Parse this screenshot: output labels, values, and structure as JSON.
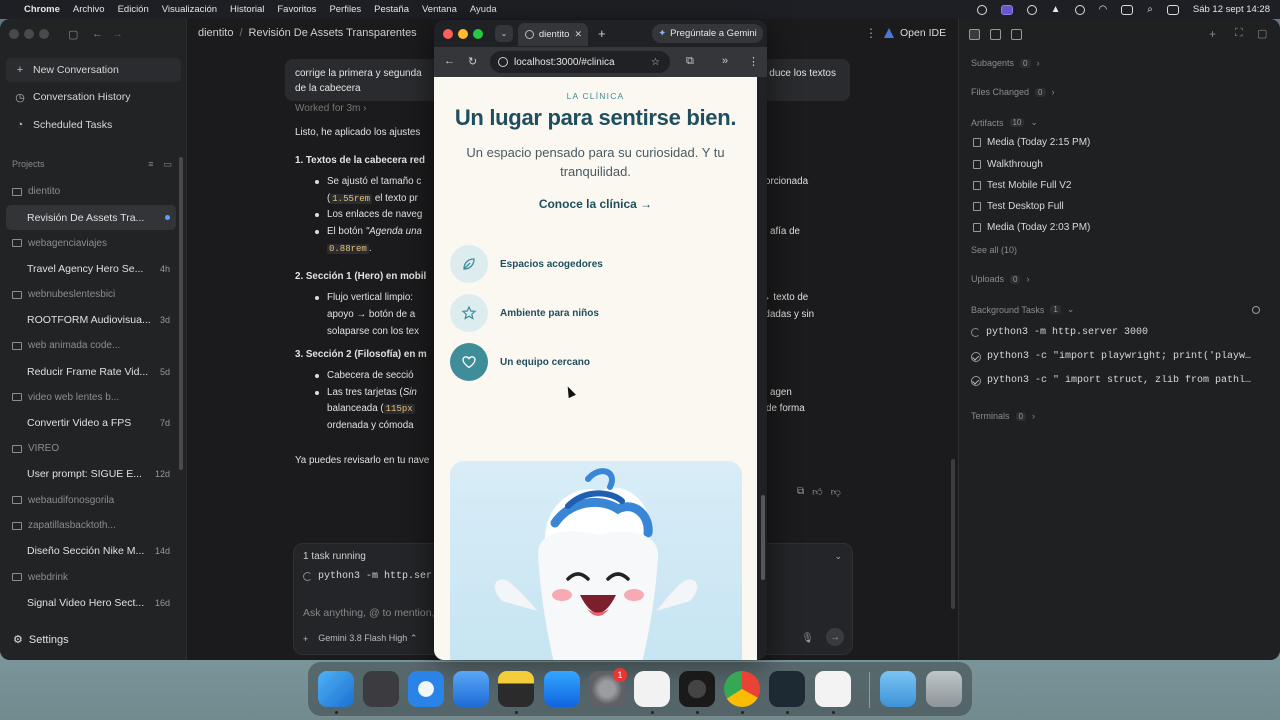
{
  "menubar": {
    "app": "Chrome",
    "items": [
      "Archivo",
      "Edición",
      "Visualización",
      "Historial",
      "Favoritos",
      "Perfiles",
      "Pestaña",
      "Ventana",
      "Ayuda"
    ],
    "datetime": "Sáb 12 sept  14:28"
  },
  "sidebar": {
    "new_conversation": "New Conversation",
    "history": "Conversation History",
    "scheduled": "Scheduled Tasks",
    "projects_label": "Projects",
    "projects": [
      {
        "group": "dientito",
        "item": "Revisión De Assets Tra...",
        "age": ""
      },
      {
        "group": "webagenciaviajes",
        "item": "Travel Agency Hero Se...",
        "age": "4h"
      },
      {
        "group": "webnubeslentesbici",
        "item": "ROOTFORM Audiovisua...",
        "age": "3d"
      },
      {
        "group": "web animada code...",
        "item": "Reducir Frame Rate Vid...",
        "age": "5d"
      },
      {
        "group": "video web lentes b...",
        "item": "Convertir Video a FPS",
        "age": "7d"
      },
      {
        "group": "VIREO",
        "item": "User prompt: SIGUE E...",
        "age": "12d"
      },
      {
        "group": "webaudifonosgorila",
        "item": "",
        "age": ""
      },
      {
        "group": "zapatillasbacktoth...",
        "item": "Diseño Sección Nike M...",
        "age": "14d"
      },
      {
        "group": "webdrink",
        "item": "Signal Video Hero Sect...",
        "age": "16d"
      }
    ],
    "settings": "Settings"
  },
  "center": {
    "breadcrumb_project": "dientito",
    "breadcrumb_title": "Revisión De Assets Transparentes",
    "open_ide": "Open IDE",
    "user_msg_1": "corrige la primera y segunda",
    "user_msg_right": "duce los textos",
    "user_msg_2": "de la cabecera",
    "worked": "Worked for 3m",
    "resp": {
      "intro": "Listo, he aplicado los ajustes",
      "h1": "1. Textos de la cabecera red",
      "b1a": "Se ajustó el tamaño c",
      "b1a_r": "orcionada",
      "b1b_code": "1.55rem",
      "b1b": "el texto pr",
      "b1c": "Los enlaces de naveg",
      "b1d": "El botón ",
      "b1d_i": "\"Agenda una",
      "b1d_r": "afía de",
      "b1e_code": "0.88rem",
      "h2": "2. Sección 1 (Hero) en mobil",
      "b2a": "Flujo vertical limpio: ",
      "b2a_r": "s) → texto de",
      "b2b": "apoyo → botón de a",
      "b2b_r": "cuidadas y sin",
      "b2c": "solaparse con los tex",
      "h3": "3. Sección 2 (Filosofía) en m",
      "b3a": "Cabecera de secció",
      "b3b": "Las tres tarjetas (",
      "b3b_i": "Sin",
      "b3b_r": "agen",
      "b3c": "balanceada (",
      "b3c_code": "115px",
      "b3c_r": "de forma",
      "b3d": "ordenada y cómoda",
      "closing": "Ya puedes revisarlo en tu nave"
    },
    "task": {
      "header": "1 task running",
      "cmd": "python3 -m http.ser",
      "placeholder": "Ask anything, @ to mention,",
      "model": "Gemini 3.8 Flash High"
    }
  },
  "right": {
    "subagents": "Subagents",
    "subagents_n": "0",
    "files": "Files Changed",
    "files_n": "0",
    "artifacts": "Artifacts",
    "artifacts_n": "10",
    "artifact_items": [
      "Media (Today 2:15 PM)",
      "Walkthrough",
      "Test Mobile Full V2",
      "Test Desktop Full",
      "Media (Today 2:03 PM)"
    ],
    "see_all": "See all (10)",
    "uploads": "Uploads",
    "uploads_n": "0",
    "bg_tasks": "Background Tasks",
    "bg_tasks_n": "1",
    "bg_items": [
      "python3 -m http.server 3000",
      "python3 -c \"import playwright; print('playw…",
      "python3 -c \" import struct, zlib from pathl…"
    ],
    "terminals": "Terminals",
    "terminals_n": "0"
  },
  "chrome": {
    "tab_title": "dientito",
    "gemini": "Pregúntale a Gemini",
    "url": "localhost:3000/#clinica",
    "page": {
      "eyebrow": "LA CLÍNICA",
      "title": "Un lugar para sentirse bien.",
      "subtitle": "Un espacio pensado para su curiosidad. Y tu tranquilidad.",
      "cta": "Conoce la clínica →",
      "features": [
        "Espacios acogedores",
        "Ambiente para niños",
        "Un equipo cercano"
      ]
    }
  },
  "dock": {
    "badge": "1"
  }
}
